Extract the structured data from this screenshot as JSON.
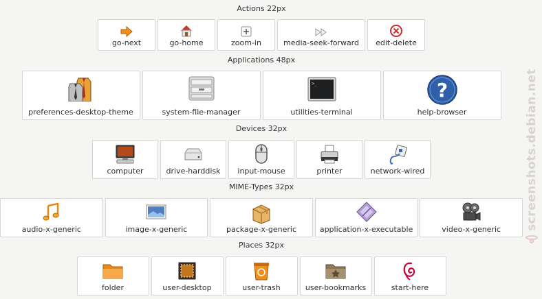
{
  "sections": {
    "actions": {
      "title": "Actions 22px",
      "items": [
        {
          "label": "go-next",
          "icon": "go-next-icon"
        },
        {
          "label": "go-home",
          "icon": "go-home-icon"
        },
        {
          "label": "zoom-in",
          "icon": "zoom-in-icon"
        },
        {
          "label": "media-seek-forward",
          "icon": "media-seek-forward-icon"
        },
        {
          "label": "edit-delete",
          "icon": "edit-delete-icon"
        }
      ]
    },
    "applications": {
      "title": "Applications 48px",
      "items": [
        {
          "label": "preferences-desktop-theme",
          "icon": "preferences-desktop-theme-icon"
        },
        {
          "label": "system-file-manager",
          "icon": "system-file-manager-icon"
        },
        {
          "label": "utilities-terminal",
          "icon": "utilities-terminal-icon"
        },
        {
          "label": "help-browser",
          "icon": "help-browser-icon"
        }
      ]
    },
    "devices": {
      "title": "Devices 32px",
      "items": [
        {
          "label": "computer",
          "icon": "computer-icon"
        },
        {
          "label": "drive-harddisk",
          "icon": "drive-harddisk-icon"
        },
        {
          "label": "input-mouse",
          "icon": "input-mouse-icon"
        },
        {
          "label": "printer",
          "icon": "printer-icon"
        },
        {
          "label": "network-wired",
          "icon": "network-wired-icon"
        }
      ]
    },
    "mimetypes": {
      "title": "MIME-Types 32px",
      "items": [
        {
          "label": "audio-x-generic",
          "icon": "audio-x-generic-icon"
        },
        {
          "label": "image-x-generic",
          "icon": "image-x-generic-icon"
        },
        {
          "label": "package-x-generic",
          "icon": "package-x-generic-icon"
        },
        {
          "label": "application-x-executable",
          "icon": "application-x-executable-icon"
        },
        {
          "label": "video-x-generic",
          "icon": "video-x-generic-icon"
        }
      ]
    },
    "places": {
      "title": "Places 32px",
      "items": [
        {
          "label": "folder",
          "icon": "folder-icon"
        },
        {
          "label": "user-desktop",
          "icon": "user-desktop-icon"
        },
        {
          "label": "user-trash",
          "icon": "user-trash-icon"
        },
        {
          "label": "user-bookmarks",
          "icon": "user-bookmarks-icon"
        },
        {
          "label": "start-here",
          "icon": "start-here-icon"
        }
      ]
    }
  },
  "watermark": {
    "text": "screenshots.debian.net"
  },
  "colors": {
    "accent_orange": "#f0901c",
    "help_blue": "#2e5fa8",
    "delete_red": "#d12a2a",
    "debian_red": "#c70036"
  }
}
